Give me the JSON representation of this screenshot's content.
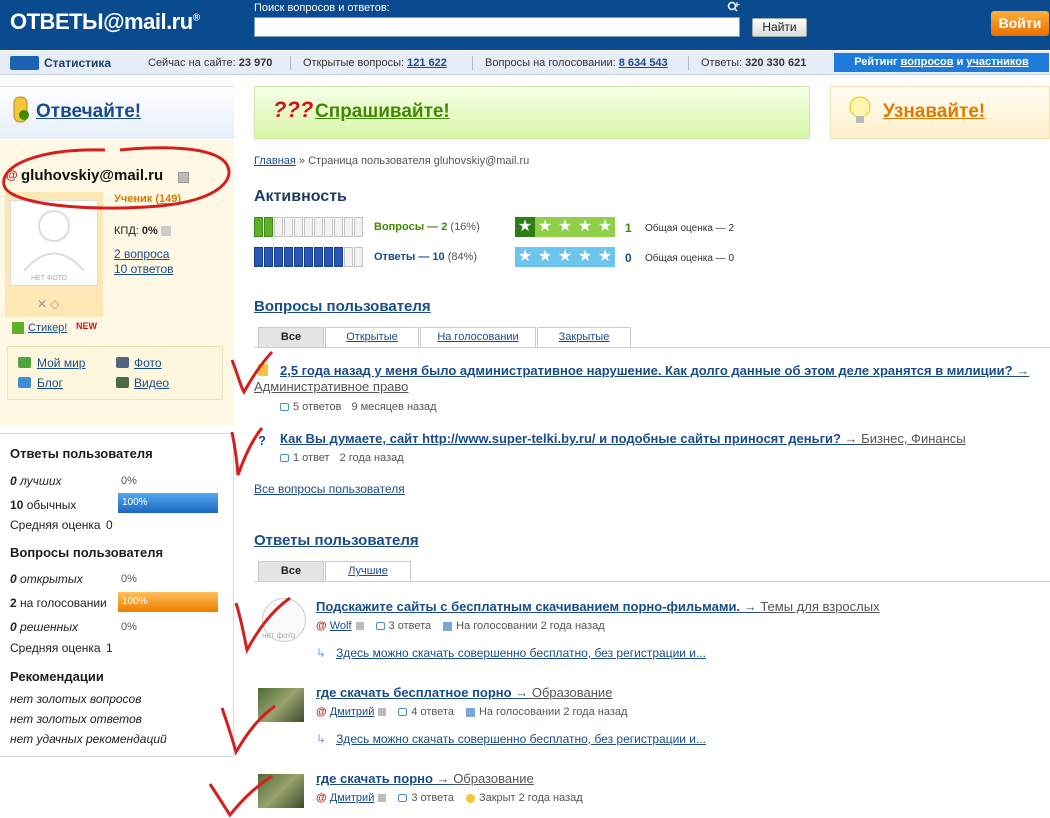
{
  "header": {
    "logo": "ОТВЕТЫ@mail.ru",
    "logo_mark": "®",
    "search_label": "Поиск вопросов и ответов:",
    "search_value": "",
    "search_button": "Найти",
    "login_button": "Войти"
  },
  "stats": {
    "title": "Статистика",
    "online_label": "Сейчас на сайте:",
    "online_value": "23 970",
    "open_label": "Открытые вопросы:",
    "open_value": "121 622",
    "voting_label": "Вопросы на голосовании:",
    "voting_value": "8 634 543",
    "answers_label": "Ответы:",
    "answers_value": "320 330 621",
    "rating_prefix": "Рейтинг",
    "rating_link1": "вопросов",
    "rating_and": "и",
    "rating_link2": "участников"
  },
  "promo": {
    "answer": "Отвечайте!",
    "ask": "Спрашивайте!",
    "learn": "Узнавайте!"
  },
  "user": {
    "email": "gluhovskiy@mail.ru",
    "rank_label": "Ученик",
    "rank_points": "149",
    "no_photo": "НЕТ ФОТО",
    "kpd_label": "КПД:",
    "kpd_value": "0%",
    "questions_link": "2 вопроса",
    "answers_link": "10 ответов",
    "sticker": "Стикер!",
    "new_badge": "NEW",
    "links": {
      "my_world": "Мой мир",
      "photo": "Фото",
      "blog": "Блог",
      "video": "Видео"
    }
  },
  "user_answers_stats": {
    "title": "Ответы пользователя",
    "best_count": "0",
    "best_label": "лучших",
    "best_pct": "0%",
    "normal_count": "10",
    "normal_label": "обычных",
    "normal_pct": "100%",
    "normal_fill": 1.0,
    "avg_label": "Средняя оценка",
    "avg_value": "0"
  },
  "user_questions_stats": {
    "title": "Вопросы пользователя",
    "open_count": "0",
    "open_label": "открытых",
    "open_pct": "0%",
    "voting_count": "2",
    "voting_label": "на голосовании",
    "voting_pct": "100%",
    "voting_fill": 1.0,
    "solved_count": "0",
    "solved_label": "решенных",
    "solved_pct": "0%",
    "avg_label": "Средняя оценка",
    "avg_value": "1"
  },
  "recommendations": {
    "title": "Рекомендации",
    "items": [
      "нет золотых вопросов",
      "нет золотых ответов",
      "нет удачных рекомендаций"
    ]
  },
  "breadcrumb": {
    "home": "Главная",
    "sep": " » ",
    "current": "Страница пользователя gluhovskiy@mail.ru"
  },
  "activity": {
    "title": "Активность",
    "questions_label": "Вопросы — 2",
    "questions_pct": "(16%)",
    "questions_fill": 0.16,
    "answers_label": "Ответы — 10",
    "answers_pct": "(84%)",
    "answers_fill": 0.84,
    "q_rating_num": "1",
    "q_rating_desc": "Общая оценка — 2",
    "q_stars": 1,
    "a_rating_num": "0",
    "a_rating_desc": "Общая оценка — 0",
    "a_stars": 0
  },
  "questions_section": {
    "title": "Вопросы пользователя",
    "tabs": [
      "Все",
      "Открытые",
      "На голосовании",
      "Закрытые"
    ],
    "items": [
      {
        "title": "2,5 года назад у меня было административное нарушение. Как долго данные об этом деле хранятся в милиции?",
        "arrow": "→",
        "category": "Административное право",
        "answers": "5 ответов",
        "time": "9 месяцев назад"
      },
      {
        "title": "Как Вы думаете, сайт http://www.super-telki.by.ru/ и подобные сайты приносят деньги?",
        "arrow": "→",
        "category": "Бизнес, Финансы",
        "answers": "1 ответ",
        "time": "2 года назад"
      }
    ],
    "all_link": "Все вопросы пользователя"
  },
  "answers_section": {
    "title": "Ответы пользователя",
    "tabs": [
      "Все",
      "Лучшие"
    ],
    "items": [
      {
        "title": "Подскажите сайты с бесплатным скачиванием порно-фильмами.",
        "arrow": "→",
        "category": "Темы для взрослых",
        "author": "Wolf",
        "answers": "3 ответа",
        "status": "На голосовании 2 года назад",
        "answer_text": "Здесь можно скачать совершенно бесплатно, без регистрации и...",
        "no_photo": "нет фото"
      },
      {
        "title": "где скачать бесплатное порно",
        "arrow": "→",
        "category": "Образование",
        "author": "Дмитрий",
        "answers": "4 ответа",
        "status": "На голосовании 2 года назад",
        "answer_text": "Здесь можно скачать совершенно бесплатно, без регистрации и..."
      },
      {
        "title": "где скачать порно",
        "arrow": "→",
        "category": "Образование",
        "author": "Дмитрий",
        "answers": "3 ответа",
        "status": "Закрыт 2 года назад"
      }
    ]
  }
}
